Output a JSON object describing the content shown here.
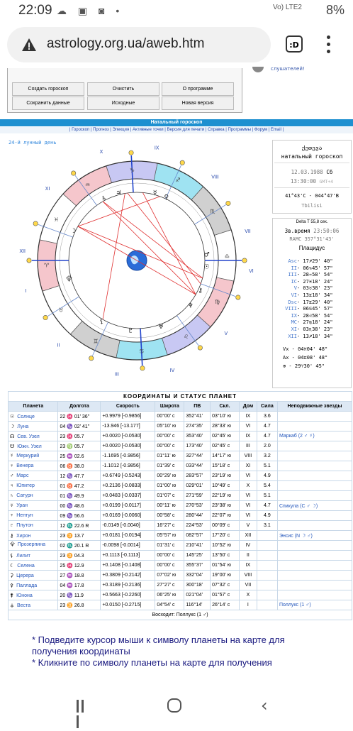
{
  "status": {
    "time": "22:09",
    "battery": "8%",
    "signal": "Vo) LTE2",
    "icons": "☁ ▣ ◙ •"
  },
  "browser": {
    "url": "astrology.org.ua/aweb.htm",
    "tab_label": ":D"
  },
  "top_buttons": [
    "Создать гороскоп",
    "Очистить",
    "О программе",
    "Сохранить данные",
    "Исходные",
    "Новая версия"
  ],
  "listeners_text": "слушателей!",
  "natal_title": "Натальный гороскоп",
  "menu": "| Гороскоп | Прогноз | Элекция | Активные точки | Версия для печати | Справка | Программы | Форум | Email |",
  "lunar_day": "24-й лунный день",
  "houses": [
    "I",
    "II",
    "III",
    "IV",
    "V",
    "VI",
    "VII",
    "VIII",
    "IX",
    "X",
    "XI",
    "XII"
  ],
  "info": {
    "name": "ქეთევა",
    "type": "натальный гороскоп",
    "date": "12.03.1988",
    "day": "Сб",
    "time": "13:30:00",
    "gmt": "GMT+4",
    "coords": "41°43'С - 044°47'В",
    "city": "Tbilisi"
  },
  "cusps": {
    "delta_t": "Delta T   55,8 сек.",
    "star_time_label": "Зв.время",
    "star_time": "23:50:06",
    "ramc": "RAMC 357°31'43'",
    "system": "Плацидус",
    "rows": [
      {
        "n": "Asc",
        "v": "- 17♐29' 40\""
      },
      {
        "n": "II",
        "v": "- 06♑45' 57\""
      },
      {
        "n": "III",
        "v": "- 28♒58' 54\""
      },
      {
        "n": "IC",
        "v": "- 27♓18' 24\""
      },
      {
        "n": "V",
        "v": "- 03♉38' 23\""
      },
      {
        "n": "VI",
        "v": "- 13♊18' 34\""
      },
      {
        "n": "Dsc",
        "v": "- 17♊29' 40\""
      },
      {
        "n": "VIII",
        "v": "- 06♋45' 57\""
      },
      {
        "n": "IX",
        "v": "- 28♌58' 54\""
      },
      {
        "n": "MC",
        "v": "- 27♍18' 24\""
      },
      {
        "n": "XI",
        "v": "- 03♏38' 23\""
      },
      {
        "n": "XII",
        "v": "- 13♐18' 34\""
      }
    ],
    "vx": "Vx  -  04♓04' 48\"",
    "ax": "Ax  -  04♊08' 48\"",
    "pf": "⊕  -  29♈30' 45\""
  },
  "table": {
    "title": "КООРДИНАТЫ И СТАТУС ПЛАНЕТ",
    "headers": [
      "Планета",
      "Долгота",
      "Скорость",
      "Широта",
      "ПВ",
      "Скл.",
      "Дом",
      "Сила",
      "Неподвижные звезды"
    ],
    "rows": [
      [
        "☉",
        "Солнце",
        "22 ♓ 01' 36\"",
        "+0.9979 [-0.9856]",
        "00°00' с",
        "352°41'",
        "03°10' ю",
        "IX",
        "3.6",
        ""
      ],
      [
        "☽",
        "Луна",
        "04 ♑ 02' 41\"",
        "-13.946 [-13.177]",
        "05°10' ю",
        "274°35'",
        "28°33' ю",
        "VI",
        "4.7",
        ""
      ],
      [
        "☊",
        "Сев. Узел",
        "23 ♓ 05.7",
        "+0.0020 [-0.0530]",
        "00°00' с",
        "353°40'",
        "02°45' ю",
        "IX",
        "4.7",
        "Маркаб (2 ♂ ☿)"
      ],
      [
        "☋",
        "Южн. Узел",
        "23 ♍ 05.7",
        "+0.0020 [-0.0530]",
        "00°00' с",
        "173°40'",
        "02°45' с",
        "III",
        "2.0",
        ""
      ],
      [
        "☿",
        "Меркурий",
        "25 ♒ 02.6",
        "-1.1695 [-0.9856]",
        "01°11' ю",
        "327°44'",
        "14°17' ю",
        "VIII",
        "3.2",
        ""
      ],
      [
        "♀",
        "Венера",
        "06 ♉ 38.0",
        "-1.1012 [-0.9856]",
        "01°39' с",
        "033°44'",
        "15°18' с",
        "XI",
        "5.1",
        ""
      ],
      [
        "♂",
        "Марс",
        "12 ♑ 47.7",
        "+0.6749 [-0.5243]",
        "00°29' ю",
        "283°57'",
        "23°19' ю",
        "VI",
        "4.9",
        ""
      ],
      [
        "♃",
        "Юпитер",
        "01 ♉ 47.2",
        "+0.2136 [-0.0833]",
        "01°00' ю",
        "029°01'",
        "10°49' с",
        "X",
        "5.4",
        ""
      ],
      [
        "♄",
        "Сатурн",
        "01 ♑ 49.9",
        "+0.0483 [-0.0337]",
        "01°07' с",
        "271°59'",
        "22°19' ю",
        "VI",
        "5.1",
        ""
      ],
      [
        "♅",
        "Уран",
        "00 ♑ 48.6",
        "+0.0199 [-0.0117]",
        "00°11' ю",
        "270°53'",
        "23°38' ю",
        "VI",
        "4.7",
        "Спикула (С ♂ ☽)"
      ],
      [
        "♆",
        "Нептун",
        "09 ♑ 56.6",
        "+0.0169 [-0.0060]",
        "00°58' с",
        "280°44'",
        "22°07' ю",
        "VI",
        "4.9",
        ""
      ],
      [
        "♇",
        "Плутон",
        "12 ♏ 22.6  R",
        "-0.0149 [-0.0040]",
        "16°27' с",
        "224°53'",
        "00°09' с",
        "V",
        "3.1",
        ""
      ],
      [
        "⚷",
        "Хирон",
        "23 ♊ 13.7",
        "+0.0181 [-0.0194]",
        "05°57' ю",
        "082°57'",
        "17°20' с",
        "XII",
        "",
        "Энсис (N ☽ ♂)"
      ],
      [
        "⯓",
        "Прозерпина",
        "02 ♏ 20.1  R",
        "-0.0098 [-0.0014]",
        "01°31' с",
        "210°41'",
        "10°52' ю",
        "IV",
        "",
        ""
      ],
      [
        "⚸",
        "Лилит",
        "23 ♊ 04.3",
        "+0.1113 [-0.1113]",
        "00°00' с",
        "145°25'",
        "13°50' с",
        "II",
        "",
        ""
      ],
      [
        "☾",
        "Селена",
        "25 ♓ 12.9",
        "+0.1408 [-0.1408]",
        "00°00' с",
        "355°37'",
        "01°54' ю",
        "IX",
        "",
        ""
      ],
      [
        "⚳",
        "Церера",
        "27 ♒ 18.8",
        "+0.3809 [-0.2142]",
        "07°02' ю",
        "332°04'",
        "19°00' ю",
        "VIII",
        "",
        ""
      ],
      [
        "⚴",
        "Паллада",
        "04 ♒ 17.8",
        "+0.3189 [-0.2136]",
        "27°27' с",
        "300°18'",
        "07°32' с",
        "VII",
        "",
        ""
      ],
      [
        "⚵",
        "Юнона",
        "20 ♑ 11.9",
        "+0.5663 [-0.2260]",
        "06°25' ю",
        "021°04'",
        "01°57' с",
        "X",
        "",
        ""
      ],
      [
        "⚶",
        "Веста",
        "23 ♊ 26.8",
        "+0.0150 [-0.2715]",
        "04°54' с",
        "116°14'",
        "26°14' с",
        "I",
        "",
        "Поллукс (1 ♂)"
      ]
    ],
    "foot": "Восходит: Поллукс (1 ♂)"
  },
  "notes": [
    "* Подведите курсор мыши к символу планеты на карте для получения координаты",
    "* Кликните по символу планеты на карте для получения"
  ],
  "colors": {
    "accent": "#1e90d0",
    "link": "#2255bb",
    "note": "#1a1a80"
  }
}
